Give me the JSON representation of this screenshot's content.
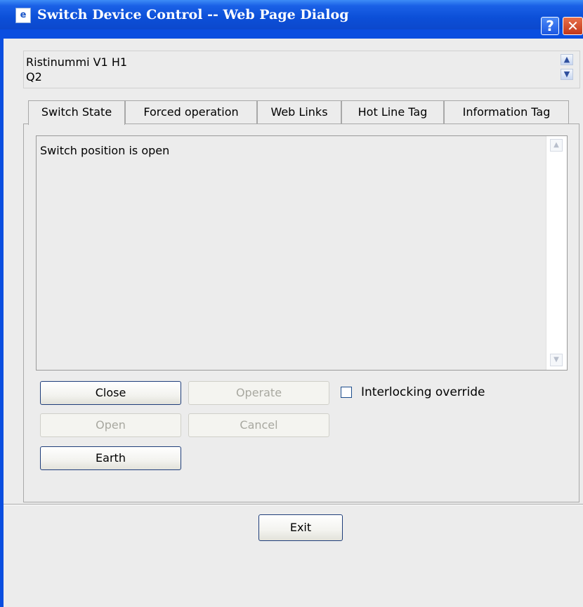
{
  "window": {
    "title": "Switch Device Control -- Web Page Dialog",
    "help_glyph": "?",
    "close_glyph": "✕"
  },
  "device": {
    "line1": "Ristinummi V1 H1",
    "line2": "Q2"
  },
  "tabs": [
    {
      "label": "Switch State",
      "active": true
    },
    {
      "label": "Forced operation",
      "active": false
    },
    {
      "label": "Web Links",
      "active": false
    },
    {
      "label": "Hot Line Tag",
      "active": false
    },
    {
      "label": "Information Tag",
      "active": false
    }
  ],
  "status": {
    "text": "Switch position is open"
  },
  "buttons": {
    "close": "Close",
    "operate": "Operate",
    "open": "Open",
    "cancel": "Cancel",
    "earth": "Earth",
    "exit": "Exit"
  },
  "interlocking": {
    "label": "Interlocking override",
    "checked": false
  },
  "colors": {
    "title_bar": "#0c4fd8",
    "dialog_bg": "#ececec",
    "button_border": "#1e3d7a"
  }
}
